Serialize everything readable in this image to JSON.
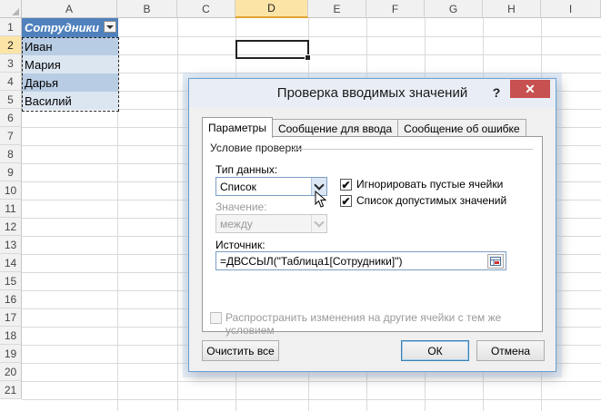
{
  "spreadsheet": {
    "columns": [
      "A",
      "B",
      "C",
      "D",
      "E",
      "F",
      "G",
      "H",
      "I"
    ],
    "selected_column": "D",
    "rows": [
      "1",
      "2",
      "3",
      "4",
      "5",
      "6",
      "7",
      "8",
      "9",
      "10",
      "11",
      "12",
      "13",
      "14",
      "15",
      "16",
      "17",
      "18",
      "19",
      "20",
      "21"
    ],
    "selected_row": "2",
    "table": {
      "header": "Сотрудники",
      "items": [
        "Иван",
        "Мария",
        "Дарья",
        "Василий"
      ]
    },
    "colors": {
      "table_header": "#4f81bd",
      "band_dark": "#b8cce4",
      "band_light": "#dce6f1",
      "header_selected": "#fce4a6"
    }
  },
  "dialog": {
    "title": "Проверка вводимых значений",
    "help": "?",
    "close": "✕",
    "tabs": [
      "Параметры",
      "Сообщение для ввода",
      "Сообщение об ошибке"
    ],
    "active_tab": 0,
    "group_title": "Условие проверки",
    "data_type_label": "Тип данных:",
    "data_type_value": "Список",
    "value_label": "Значение:",
    "value_value": "между",
    "ignore_blank_label": "Игнорировать пустые ячейки",
    "ignore_blank_checked": true,
    "in_cell_dropdown_label": "Список допустимых значений",
    "in_cell_dropdown_checked": true,
    "source_label": "Источник:",
    "source_value": "=ДВССЫЛ(\"Таблица1[Сотрудники]\")",
    "apply_all_label": "Распространить изменения на другие ячейки с тем же условием",
    "apply_all_checked": false,
    "clear_all": "Очистить все",
    "ok": "ОК",
    "cancel": "Отмена",
    "checkmark": "✔"
  }
}
